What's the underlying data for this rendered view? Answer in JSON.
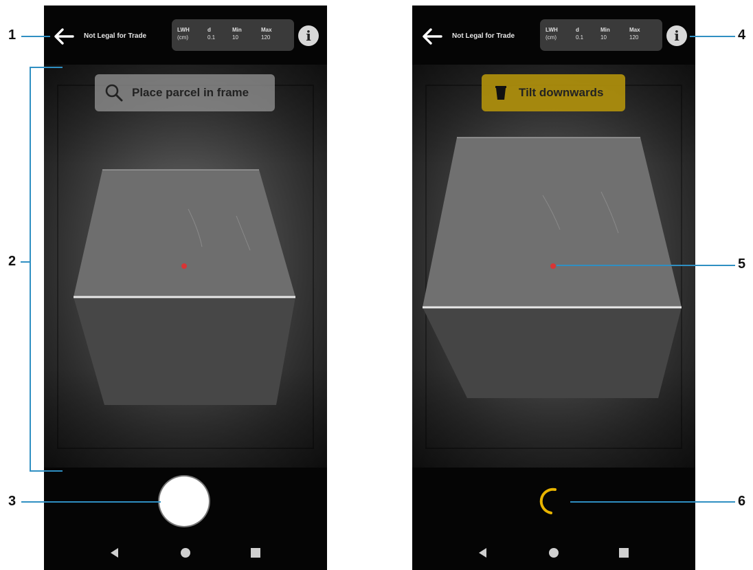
{
  "left_screen": {
    "top_bar": {
      "legal_text": "Not Legal for Trade",
      "specs": [
        {
          "header": "LWH",
          "value": "(cm)"
        },
        {
          "header": "d",
          "value": "0.1"
        },
        {
          "header": "Min",
          "value": "10"
        },
        {
          "header": "Max",
          "value": "120"
        }
      ]
    },
    "prompt": {
      "text": "Place parcel in frame",
      "icon": "search-icon"
    },
    "capture_button": {
      "icon": "shutter-button"
    }
  },
  "right_screen": {
    "top_bar": {
      "legal_text": "Not Legal for Trade",
      "specs": [
        {
          "header": "LWH",
          "value": "(cm)"
        },
        {
          "header": "d",
          "value": "0.1"
        },
        {
          "header": "Min",
          "value": "10"
        },
        {
          "header": "Max",
          "value": "120"
        }
      ]
    },
    "prompt": {
      "text": "Tilt downwards",
      "icon": "tilt-phone-icon"
    },
    "progress": {
      "icon": "loading-spinner-icon"
    }
  },
  "nav_buttons": [
    "back-triangle-icon",
    "home-circle-icon",
    "recents-square-icon"
  ],
  "callouts": [
    "1",
    "2",
    "3",
    "4",
    "5",
    "6"
  ],
  "colors": {
    "callout_line": "#2f8fc2",
    "prompt_warning": "#b0900c",
    "spinner": "#e8b400",
    "aim_dot": "#d83535"
  }
}
